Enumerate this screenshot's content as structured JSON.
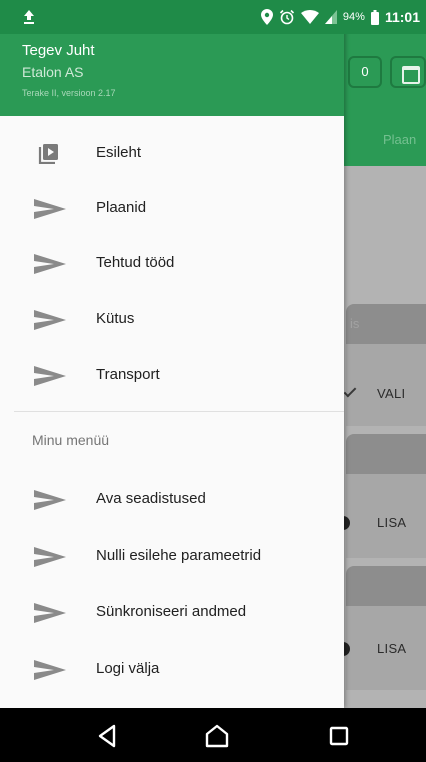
{
  "status_bar": {
    "battery": "94%",
    "time": "11:01",
    "icons": [
      "upload-icon",
      "location-pin-icon",
      "alarm-icon",
      "wifi-icon",
      "signal-icon",
      "battery-icon"
    ]
  },
  "background_app": {
    "counter_value": "0",
    "tab_label": "Plaan",
    "cards": [
      {
        "header": "is",
        "action": "VALI"
      },
      {
        "header": "",
        "action": "LISA"
      },
      {
        "header": "",
        "action": "LISA"
      }
    ]
  },
  "drawer": {
    "header": {
      "user_name": "Tegev Juht",
      "company": "Etalon AS",
      "version": "Terake II, versioon 2.17"
    },
    "main_items": [
      {
        "label": "Esileht",
        "icon": "video-play-icon"
      },
      {
        "label": "Plaanid",
        "icon": "send-arrow-icon"
      },
      {
        "label": "Tehtud tööd",
        "icon": "send-arrow-icon"
      },
      {
        "label": "Kütus",
        "icon": "send-arrow-icon"
      },
      {
        "label": "Transport",
        "icon": "send-arrow-icon"
      }
    ],
    "section_title": "Minu menüü",
    "my_items": [
      {
        "label": "Ava seadistused",
        "icon": "send-arrow-icon"
      },
      {
        "label": "Nulli esilehe parameetrid",
        "icon": "send-arrow-icon"
      },
      {
        "label": "Sünkroniseeri andmed",
        "icon": "send-arrow-icon"
      },
      {
        "label": "Logi välja",
        "icon": "send-arrow-icon"
      }
    ]
  },
  "colors": {
    "primary": "#2b9a55",
    "status_bar": "#1f8b48",
    "drawer_bg": "#fafafa",
    "icon_gray": "#8a8a8a",
    "text_dark": "#212121"
  }
}
